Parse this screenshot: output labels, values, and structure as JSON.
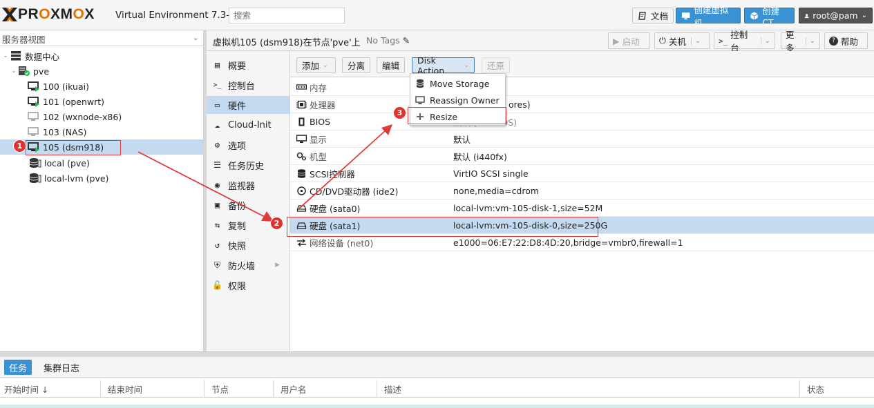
{
  "header": {
    "logo_left": "PRO",
    "logo_o1": "X",
    "logo_mid": "M",
    "logo_o2": "X",
    "brand_text": "PROXMOX",
    "version": "Virtual Environment 7.3-4",
    "search_placeholder": "搜索",
    "docs": "文档",
    "create_vm": "创建虚拟机",
    "create_ct": "创建CT",
    "user": "root@pam"
  },
  "tree": {
    "view_selector": "服务器视图",
    "items": [
      {
        "label": "数据中心",
        "type": "datacenter"
      },
      {
        "label": "pve",
        "type": "node"
      },
      {
        "label": "100 (ikuai)",
        "type": "vm-running"
      },
      {
        "label": "101 (openwrt)",
        "type": "vm-running"
      },
      {
        "label": "102 (wxnode-x86)",
        "type": "vm-stopped"
      },
      {
        "label": "103 (NAS)",
        "type": "vm-stopped"
      },
      {
        "label": "105 (dsm918)",
        "type": "vm-running"
      },
      {
        "label": "local (pve)",
        "type": "storage"
      },
      {
        "label": "local-lvm (pve)",
        "type": "storage"
      }
    ]
  },
  "content": {
    "title": "虚拟机105 (dsm918)在节点'pve'上",
    "tags": "No Tags",
    "toolbar": {
      "start": "启动",
      "shutdown": "关机",
      "console": "控制台",
      "more": "更多",
      "help": "帮助"
    }
  },
  "menu": [
    {
      "label": "概要",
      "icon": "summary-icon"
    },
    {
      "label": "控制台",
      "icon": "console-icon"
    },
    {
      "label": "硬件",
      "icon": "hardware-icon"
    },
    {
      "label": "Cloud-Init",
      "icon": "cloud-icon"
    },
    {
      "label": "选项",
      "icon": "gear-icon"
    },
    {
      "label": "任务历史",
      "icon": "list-icon"
    },
    {
      "label": "监视器",
      "icon": "eye-icon"
    },
    {
      "label": "备份",
      "icon": "floppy-icon"
    },
    {
      "label": "复制",
      "icon": "retweet-icon"
    },
    {
      "label": "快照",
      "icon": "history-icon"
    },
    {
      "label": "防火墙",
      "icon": "shield-icon"
    },
    {
      "label": "权限",
      "icon": "unlock-icon"
    }
  ],
  "hardware_toolbar": {
    "add": "添加",
    "detach": "分离",
    "edit": "编辑",
    "disk_action": "Disk Action",
    "revert": "还原"
  },
  "hardware": [
    {
      "key": "内存",
      "value": "",
      "icon": "memory-icon",
      "muted": true
    },
    {
      "key": "处理器",
      "value": "ores)",
      "icon": "cpu-icon",
      "muted": true
    },
    {
      "key": "BIOS",
      "value": "默认 (SeaBIOS)",
      "icon": "bios-icon",
      "muted": false
    },
    {
      "key": "显示",
      "value": "默认",
      "icon": "display-icon",
      "muted": true
    },
    {
      "key": "机型",
      "value": "默认 (i440fx)",
      "icon": "machine-icon",
      "muted": true
    },
    {
      "key": "SCSI控制器",
      "value": "VirtIO SCSI single",
      "icon": "database-icon",
      "muted": false
    },
    {
      "key": "CD/DVD驱动器 (ide2)",
      "value": "none,media=cdrom",
      "icon": "cdrom-icon",
      "muted": false
    },
    {
      "key": "硬盘 (sata0)",
      "value": "local-lvm:vm-105-disk-1,size=52M",
      "icon": "hdd-icon",
      "muted": false
    },
    {
      "key": "硬盘 (sata1)",
      "value": "local-lvm:vm-105-disk-0,size=250G",
      "icon": "hdd-icon",
      "muted": false
    },
    {
      "key": "网络设备 (net0)",
      "value": "e1000=06:E7:22:D8:4D:20,bridge=vmbr0,firewall=1",
      "icon": "network-icon",
      "muted": true
    }
  ],
  "disk_menu": [
    {
      "label": "Move Storage",
      "icon": "database-icon"
    },
    {
      "label": "Reassign Owner",
      "icon": "desktop-icon"
    },
    {
      "label": "Resize",
      "icon": "plus-icon"
    }
  ],
  "bottom": {
    "tabs": [
      "任务",
      "集群日志"
    ],
    "columns": [
      "开始时间 ↓",
      "结束时间",
      "节点",
      "用户名",
      "描述",
      "状态"
    ]
  },
  "annotations": [
    "1",
    "2",
    "3"
  ],
  "colors": {
    "accent": "#3892d4",
    "selection": "#c3daf1",
    "brand_orange": "#e57000",
    "annotation_red": "#e0322e"
  }
}
